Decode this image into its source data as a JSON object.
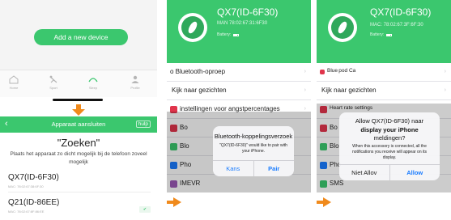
{
  "colors": {
    "accent_green": "#3bc76e",
    "arrow_orange": "#f08a1c",
    "ios_link": "#1a7cff"
  },
  "panel1": {
    "add_device_label": "Add a new device",
    "tabs": [
      {
        "icon": "home-icon",
        "label": "Home"
      },
      {
        "icon": "sport-icon",
        "label": "Sport"
      },
      {
        "icon": "sleep-icon",
        "label": "Sleep"
      },
      {
        "icon": "profile-icon",
        "label": "Profile"
      }
    ],
    "header_title": "Apparaat aansluiten",
    "header_help": "hulp",
    "search_title": "\"Zoeken\"",
    "search_hint": "Plaats het apparaat zo dicht mogelijk bij de telefoon zoveel mogelijk",
    "devices": [
      {
        "name": "QX7(ID-6F30)",
        "mac": "MAC: 78:02:67:38:6F:30"
      },
      {
        "name": "Q21(ID-86EE)",
        "mac": "MAC: 78:02:67:8F:86:EE"
      }
    ],
    "device_badge": "✔"
  },
  "panel2": {
    "device_title": "QX7(ID-6F30)",
    "device_sub": "MAN  78:02:67:31:6F30",
    "battery_label": "Battery:",
    "rows": [
      {
        "label": "o Bluetooth-oproep",
        "icon_color": "#ffffff"
      },
      {
        "label": "Kijk naar gezichten",
        "icon_color": "#ffffff"
      },
      {
        "label": "instellingen voor angstpercentages",
        "icon_color": "#e0344b"
      },
      {
        "label": "Bo",
        "icon_color": "#e0344b"
      },
      {
        "label": "Blo",
        "icon_color": "#3bc76e"
      },
      {
        "label": "Pho",
        "icon_color": "#1a7cff"
      },
      {
        "label": "IMEVR",
        "icon_color": "#9b59b6"
      }
    ],
    "alert": {
      "title": "Bluetooth-koppelingsverzoek",
      "message": "\"QX7(ID-6F30)\" would like to pair with your iPhone.",
      "cancel": "Kans",
      "confirm": "Pair"
    }
  },
  "panel3": {
    "device_title": "QX7(ID-6F30)",
    "device_sub": "MAC: 78:02:67:3F:6F:30",
    "battery_label": "Battery:",
    "rows": [
      {
        "label": "Blue pod Ca",
        "icon_color": "#e0344b"
      },
      {
        "label": "Kijk naar gezichten",
        "icon_color": "#ffffff"
      },
      {
        "label": "Heart rate settings",
        "icon_color": "#e0344b"
      },
      {
        "label": "Bo",
        "icon_color": "#e0344b"
      },
      {
        "label": "Blo",
        "icon_color": "#3bc76e"
      },
      {
        "label": "Pho",
        "icon_color": "#1a7cff"
      },
      {
        "label": "SMS",
        "icon_color": "#3bc76e"
      }
    ],
    "alert": {
      "title": "Allow QX7(ID-6F30) naar",
      "subtitle": "display your iPhone",
      "subtitle2": "meldingen?",
      "message": "When this accessory is connected, all the notifications you receive will appear on its display.",
      "cancel": "Niet Allov",
      "confirm": "Allow"
    }
  }
}
